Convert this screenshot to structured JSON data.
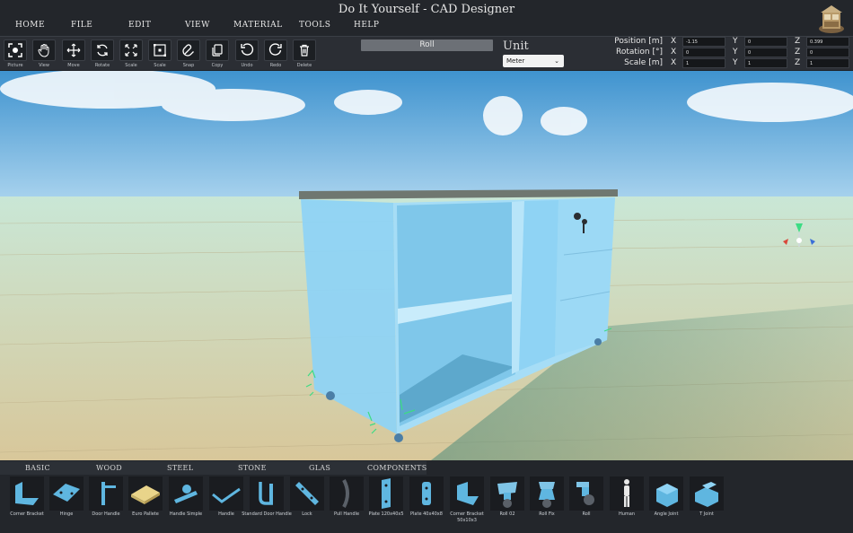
{
  "window": {
    "title": "Do It Yourself - CAD Designer"
  },
  "menu": [
    "Home",
    "File",
    "Edit",
    "View",
    "Material",
    "Tools",
    "Help"
  ],
  "toolbar": {
    "tools": [
      {
        "label": "Picture",
        "icon": "picture-icon"
      },
      {
        "label": "View",
        "icon": "hand-icon"
      },
      {
        "label": "Move",
        "icon": "move-icon"
      },
      {
        "label": "Rotate",
        "icon": "rotate-icon"
      },
      {
        "label": "Scale",
        "icon": "scale-icon"
      },
      {
        "label": "Scale",
        "icon": "scale-box-icon"
      },
      {
        "label": "Snap",
        "icon": "magnet-icon"
      },
      {
        "label": "Copy",
        "icon": "copy-icon"
      },
      {
        "label": "Undo",
        "icon": "undo-icon"
      },
      {
        "label": "Redo",
        "icon": "redo-icon"
      },
      {
        "label": "Delete",
        "icon": "trash-icon"
      }
    ],
    "selected_name": "Roll",
    "unit_label": "Unit",
    "unit_value": "Meter"
  },
  "transform": {
    "position": {
      "label": "Position [m]",
      "x": "-1.15",
      "y": "0",
      "z": "0.399"
    },
    "rotation": {
      "label": "Rotation [°]",
      "x": "0",
      "y": "0",
      "z": "0"
    },
    "scale": {
      "label": "Scale [m]",
      "x": "1",
      "y": "1",
      "z": "1"
    },
    "axes": [
      "X",
      "Y",
      "Z"
    ]
  },
  "library": {
    "tabs": [
      "Basic",
      "Wood",
      "Steel",
      "Stone",
      "Glas",
      "Components"
    ],
    "parts": [
      "Corner Bracket",
      "Hinge",
      "Door Handle",
      "Euro Pallete",
      "Handle Simple",
      "Handle",
      "Standard Door Handle",
      "Lock",
      "Pull Handle",
      "Plate 120x40x5",
      "Plate 40x40x8",
      "Corner Bracket 50x10x3",
      "Roll 02",
      "Roll Fix",
      "Roll",
      "Human",
      "Angle Joint",
      "T Joint"
    ]
  },
  "colors": {
    "cabinet": "#8fd3f4",
    "accent_green": "#3ddc84",
    "sky": "#5aa7d8",
    "floor": "#d9d0ae"
  }
}
